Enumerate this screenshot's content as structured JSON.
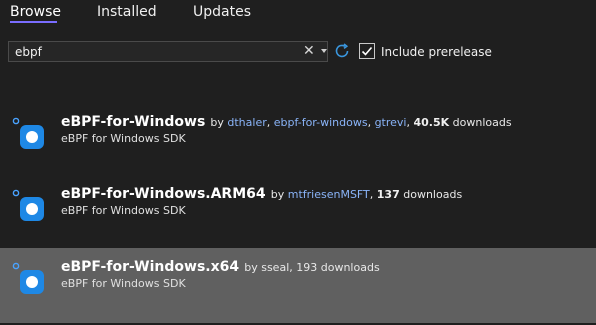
{
  "tabs": [
    {
      "label": "Browse"
    },
    {
      "label": "Installed"
    },
    {
      "label": "Updates"
    }
  ],
  "search": {
    "value": "ebpf",
    "include_prerelease_label": "Include prerelease",
    "include_prerelease_checked": true
  },
  "packages": [
    {
      "name": "eBPF-for-Windows",
      "by": "by",
      "authors": [
        "dthaler",
        "ebpf-for-windows",
        "gtrevi"
      ],
      "separator": ",",
      "downloads": "40.5K",
      "downloads_suffix": "downloads",
      "description": "eBPF for Windows SDK"
    },
    {
      "name": "eBPF-for-Windows.ARM64",
      "by": "by",
      "authors": [
        "mtfriesenMSFT"
      ],
      "separator": ",",
      "downloads": "137",
      "downloads_suffix": "downloads",
      "description": "eBPF for Windows SDK"
    },
    {
      "name": "eBPF-for-Windows.x64",
      "by": "by",
      "authors": [
        "sseal"
      ],
      "separator": ",",
      "downloads": "193",
      "downloads_suffix": "downloads",
      "description": "eBPF for Windows SDK"
    }
  ],
  "colors": {
    "accent": "#7a6dff",
    "link": "#8ab4f8",
    "selected_row": "#606060",
    "icon_blue": "#1e88e5"
  }
}
